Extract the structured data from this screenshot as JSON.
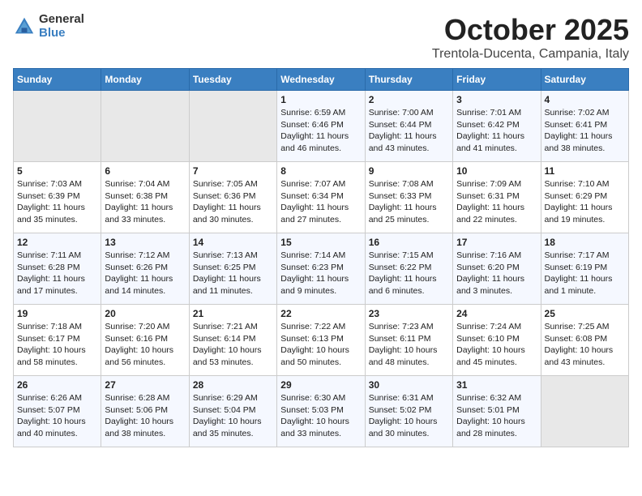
{
  "logo": {
    "general": "General",
    "blue": "Blue"
  },
  "title": "October 2025",
  "subtitle": "Trentola-Ducenta, Campania, Italy",
  "weekdays": [
    "Sunday",
    "Monday",
    "Tuesday",
    "Wednesday",
    "Thursday",
    "Friday",
    "Saturday"
  ],
  "weeks": [
    [
      {
        "day": "",
        "content": ""
      },
      {
        "day": "",
        "content": ""
      },
      {
        "day": "",
        "content": ""
      },
      {
        "day": "1",
        "content": "Sunrise: 6:59 AM\nSunset: 6:46 PM\nDaylight: 11 hours\nand 46 minutes."
      },
      {
        "day": "2",
        "content": "Sunrise: 7:00 AM\nSunset: 6:44 PM\nDaylight: 11 hours\nand 43 minutes."
      },
      {
        "day": "3",
        "content": "Sunrise: 7:01 AM\nSunset: 6:42 PM\nDaylight: 11 hours\nand 41 minutes."
      },
      {
        "day": "4",
        "content": "Sunrise: 7:02 AM\nSunset: 6:41 PM\nDaylight: 11 hours\nand 38 minutes."
      }
    ],
    [
      {
        "day": "5",
        "content": "Sunrise: 7:03 AM\nSunset: 6:39 PM\nDaylight: 11 hours\nand 35 minutes."
      },
      {
        "day": "6",
        "content": "Sunrise: 7:04 AM\nSunset: 6:38 PM\nDaylight: 11 hours\nand 33 minutes."
      },
      {
        "day": "7",
        "content": "Sunrise: 7:05 AM\nSunset: 6:36 PM\nDaylight: 11 hours\nand 30 minutes."
      },
      {
        "day": "8",
        "content": "Sunrise: 7:07 AM\nSunset: 6:34 PM\nDaylight: 11 hours\nand 27 minutes."
      },
      {
        "day": "9",
        "content": "Sunrise: 7:08 AM\nSunset: 6:33 PM\nDaylight: 11 hours\nand 25 minutes."
      },
      {
        "day": "10",
        "content": "Sunrise: 7:09 AM\nSunset: 6:31 PM\nDaylight: 11 hours\nand 22 minutes."
      },
      {
        "day": "11",
        "content": "Sunrise: 7:10 AM\nSunset: 6:29 PM\nDaylight: 11 hours\nand 19 minutes."
      }
    ],
    [
      {
        "day": "12",
        "content": "Sunrise: 7:11 AM\nSunset: 6:28 PM\nDaylight: 11 hours\nand 17 minutes."
      },
      {
        "day": "13",
        "content": "Sunrise: 7:12 AM\nSunset: 6:26 PM\nDaylight: 11 hours\nand 14 minutes."
      },
      {
        "day": "14",
        "content": "Sunrise: 7:13 AM\nSunset: 6:25 PM\nDaylight: 11 hours\nand 11 minutes."
      },
      {
        "day": "15",
        "content": "Sunrise: 7:14 AM\nSunset: 6:23 PM\nDaylight: 11 hours\nand 9 minutes."
      },
      {
        "day": "16",
        "content": "Sunrise: 7:15 AM\nSunset: 6:22 PM\nDaylight: 11 hours\nand 6 minutes."
      },
      {
        "day": "17",
        "content": "Sunrise: 7:16 AM\nSunset: 6:20 PM\nDaylight: 11 hours\nand 3 minutes."
      },
      {
        "day": "18",
        "content": "Sunrise: 7:17 AM\nSunset: 6:19 PM\nDaylight: 11 hours\nand 1 minute."
      }
    ],
    [
      {
        "day": "19",
        "content": "Sunrise: 7:18 AM\nSunset: 6:17 PM\nDaylight: 10 hours\nand 58 minutes."
      },
      {
        "day": "20",
        "content": "Sunrise: 7:20 AM\nSunset: 6:16 PM\nDaylight: 10 hours\nand 56 minutes."
      },
      {
        "day": "21",
        "content": "Sunrise: 7:21 AM\nSunset: 6:14 PM\nDaylight: 10 hours\nand 53 minutes."
      },
      {
        "day": "22",
        "content": "Sunrise: 7:22 AM\nSunset: 6:13 PM\nDaylight: 10 hours\nand 50 minutes."
      },
      {
        "day": "23",
        "content": "Sunrise: 7:23 AM\nSunset: 6:11 PM\nDaylight: 10 hours\nand 48 minutes."
      },
      {
        "day": "24",
        "content": "Sunrise: 7:24 AM\nSunset: 6:10 PM\nDaylight: 10 hours\nand 45 minutes."
      },
      {
        "day": "25",
        "content": "Sunrise: 7:25 AM\nSunset: 6:08 PM\nDaylight: 10 hours\nand 43 minutes."
      }
    ],
    [
      {
        "day": "26",
        "content": "Sunrise: 6:26 AM\nSunset: 5:07 PM\nDaylight: 10 hours\nand 40 minutes."
      },
      {
        "day": "27",
        "content": "Sunrise: 6:28 AM\nSunset: 5:06 PM\nDaylight: 10 hours\nand 38 minutes."
      },
      {
        "day": "28",
        "content": "Sunrise: 6:29 AM\nSunset: 5:04 PM\nDaylight: 10 hours\nand 35 minutes."
      },
      {
        "day": "29",
        "content": "Sunrise: 6:30 AM\nSunset: 5:03 PM\nDaylight: 10 hours\nand 33 minutes."
      },
      {
        "day": "30",
        "content": "Sunrise: 6:31 AM\nSunset: 5:02 PM\nDaylight: 10 hours\nand 30 minutes."
      },
      {
        "day": "31",
        "content": "Sunrise: 6:32 AM\nSunset: 5:01 PM\nDaylight: 10 hours\nand 28 minutes."
      },
      {
        "day": "",
        "content": ""
      }
    ]
  ]
}
